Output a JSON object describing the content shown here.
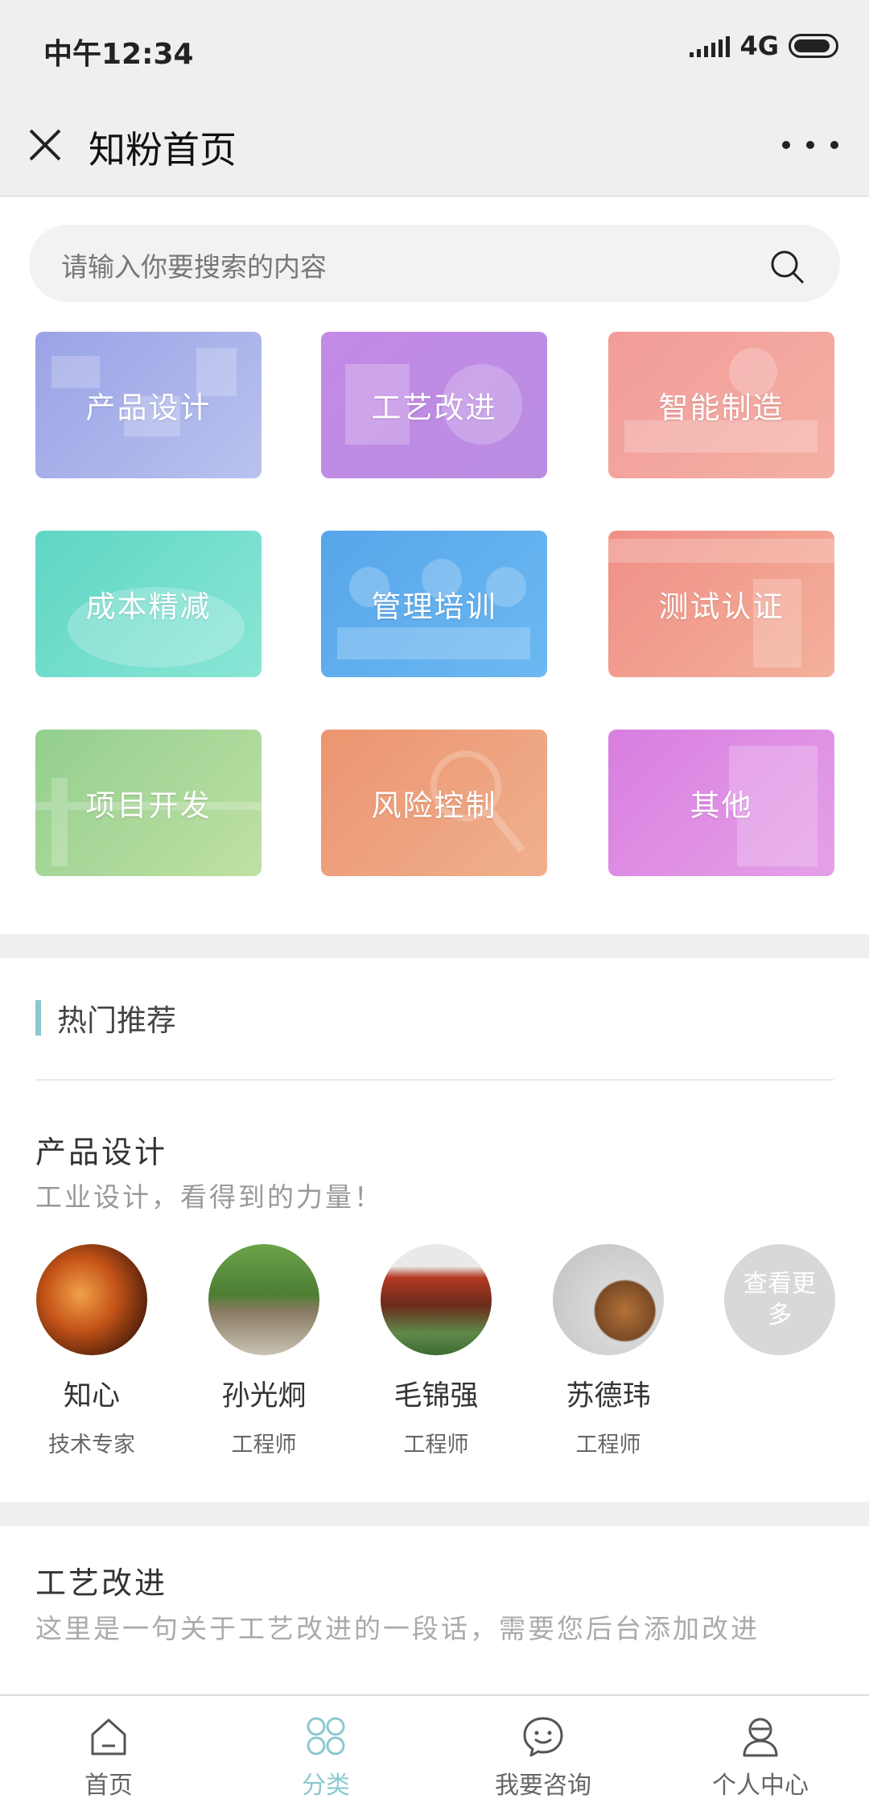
{
  "status_bar": {
    "time": "中午12:34",
    "network": "4G"
  },
  "nav": {
    "title": "知粉首页"
  },
  "search": {
    "placeholder": "请输入你要搜索的内容"
  },
  "categories": [
    {
      "label": "产品设计",
      "color": "#9aa3e6"
    },
    {
      "label": "工艺改进",
      "color": "#c48ae6"
    },
    {
      "label": "智能制造",
      "color": "#f29c9a"
    },
    {
      "label": "成本精减",
      "color": "#5fd6c4"
    },
    {
      "label": "管理培训",
      "color": "#57a6ea"
    },
    {
      "label": "测试认证",
      "color": "#ef8f86"
    },
    {
      "label": "项目开发",
      "color": "#93cf8e"
    },
    {
      "label": "风险控制",
      "color": "#ec9470"
    },
    {
      "label": "其他",
      "color": "#d87ee0"
    }
  ],
  "hot": {
    "title": "热门推荐",
    "accent": "#8cc8d0"
  },
  "section1": {
    "title": "产品设计",
    "subtitle": "工业设计，看得到的力量！",
    "people": [
      {
        "name": "知心",
        "role": "技术专家"
      },
      {
        "name": "孙光炯",
        "role": "工程师"
      },
      {
        "name": "毛锦强",
        "role": "工程师"
      },
      {
        "name": "苏德玮",
        "role": "工程师"
      }
    ],
    "more": "查看更多"
  },
  "section2": {
    "title": "工艺改进",
    "desc": "这里是一句关于工艺改进的一段话，需要您后台添加改进"
  },
  "tabs": [
    {
      "label": "首页",
      "icon": "home-icon"
    },
    {
      "label": "分类",
      "icon": "category-icon"
    },
    {
      "label": "我要咨询",
      "icon": "chat-icon"
    },
    {
      "label": "个人中心",
      "icon": "user-icon"
    }
  ]
}
